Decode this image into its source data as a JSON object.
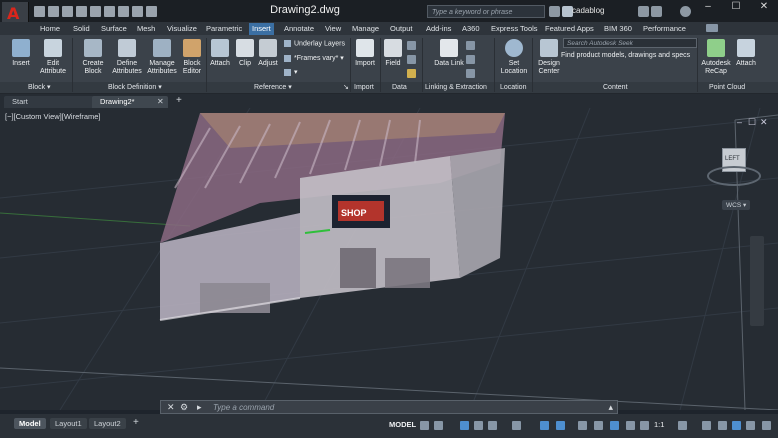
{
  "app": {
    "title": "Drawing2.dwg",
    "search_placeholder": "Type a keyword or phrase",
    "user": "cadablog"
  },
  "ribbon_tabs": [
    "Home",
    "Solid",
    "Surface",
    "Mesh",
    "Visualize",
    "Parametric",
    "Insert",
    "Annotate",
    "View",
    "Manage",
    "Output",
    "Add-ins",
    "A360",
    "Express Tools",
    "Featured Apps",
    "BIM 360",
    "Performance"
  ],
  "active_tab": "Insert",
  "ribbon": {
    "block": {
      "label": "Block ▾",
      "insert": "Insert",
      "edit_attribute": "Edit Attribute",
      "create_block": "Create Block"
    },
    "block_definition": {
      "label": "Block Definition ▾",
      "define_attributes": "Define Attributes",
      "manage_attributes": "Manage Attributes",
      "block_editor": "Block Editor"
    },
    "reference": {
      "label": "Reference ▾",
      "attach": "Attach",
      "clip": "Clip",
      "adjust": "Adjust",
      "underlay_layers": "Underlay Layers",
      "frames_vary": "*Frames vary*"
    },
    "import": {
      "label": "Import",
      "import_btn": "Import"
    },
    "data": {
      "label": "Data",
      "field": "Field"
    },
    "linking": {
      "label": "Linking & Extraction",
      "data_link": "Data Link"
    },
    "location": {
      "label": "Location",
      "set_location": "Set Location"
    },
    "content": {
      "label": "Content",
      "design_center": "Design Center",
      "seek_placeholder": "Search Autodesk Seek",
      "seek_sub": "Find product models, drawings and specs"
    },
    "point_cloud": {
      "label": "Point Cloud",
      "autodesk_recap": "Autodesk ReCap",
      "attach": "Attach"
    }
  },
  "doc_tabs": [
    {
      "label": "Start"
    },
    {
      "label": "Drawing2*"
    }
  ],
  "viewport": {
    "label": "[−][Custom View][Wireframe]",
    "viewcube_face": "LEFT",
    "wcs": "WCS ▾",
    "poster_text": "SHOP"
  },
  "command_line": {
    "placeholder": "Type a command"
  },
  "status_bar": {
    "layouts": [
      "Model",
      "Layout1",
      "Layout2"
    ],
    "model": "MODEL",
    "scale": "1:1"
  },
  "colors": {
    "accent": "#3b6fa3",
    "autocad_red": "#d8261c"
  }
}
